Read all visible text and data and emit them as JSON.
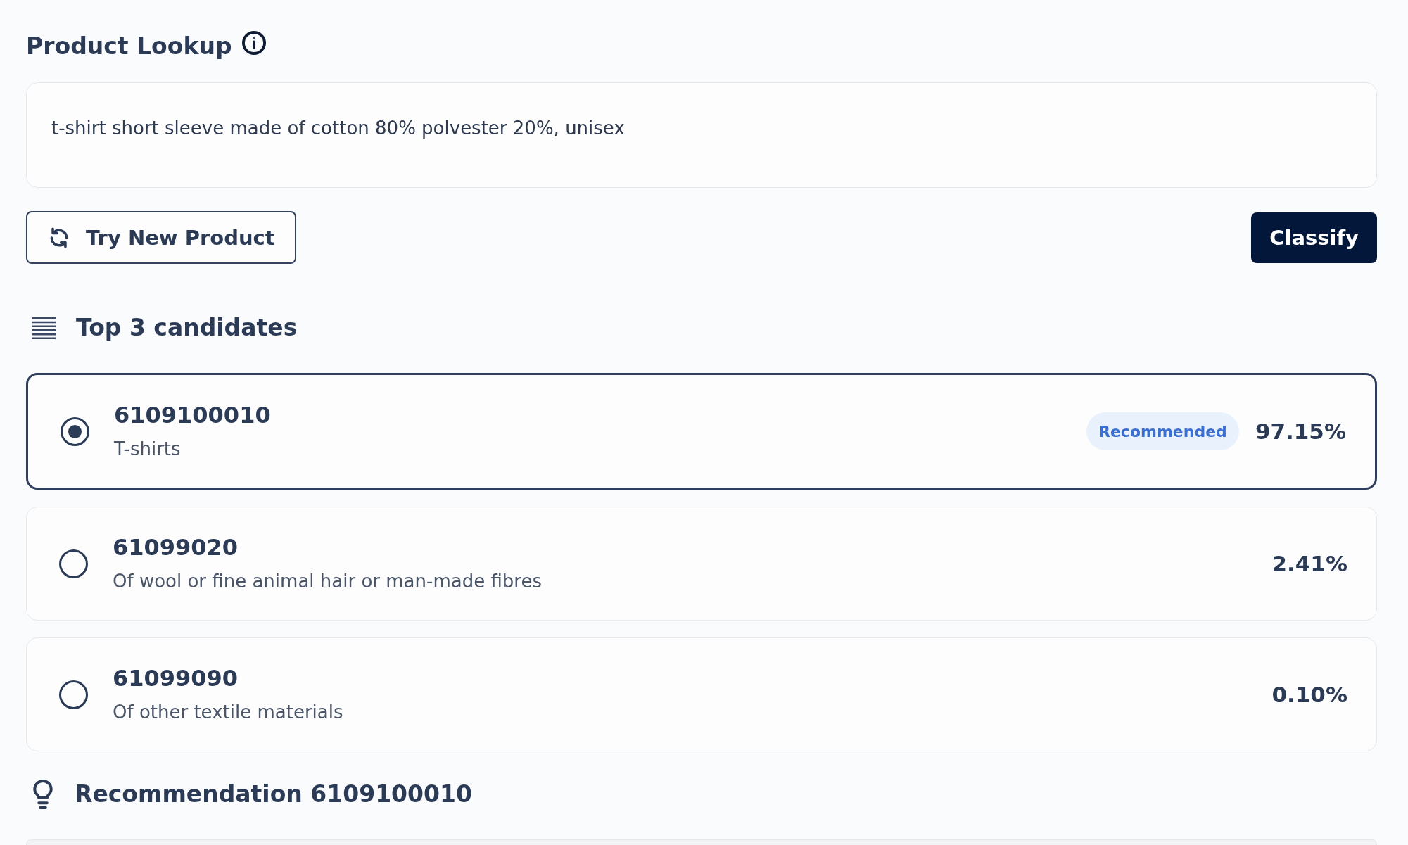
{
  "lookup": {
    "title": "Product Lookup",
    "input": {
      "value": "t-shirt short sleeve made of cotton 80% polvester 20%, unisex"
    },
    "buttons": [
      {
        "label": "Try New Product",
        "kind": "secondary"
      },
      {
        "label": "Classify",
        "kind": "primary"
      }
    ]
  },
  "candidates": {
    "title": "Top 3 candidates",
    "items": [
      {
        "code": "6109100010",
        "description": "T-shirts",
        "badge": "Recommended",
        "score": "97.15%",
        "selected": true
      },
      {
        "code": "61099020",
        "description": "Of wool or fine animal hair or man-made fibres",
        "score": "2.41%",
        "selected": false
      },
      {
        "code": "61099090",
        "description": "Of other textile materials",
        "score": "0.10%",
        "selected": false
      }
    ]
  },
  "recommendation": {
    "title": "Recommendation 6109100010"
  }
}
